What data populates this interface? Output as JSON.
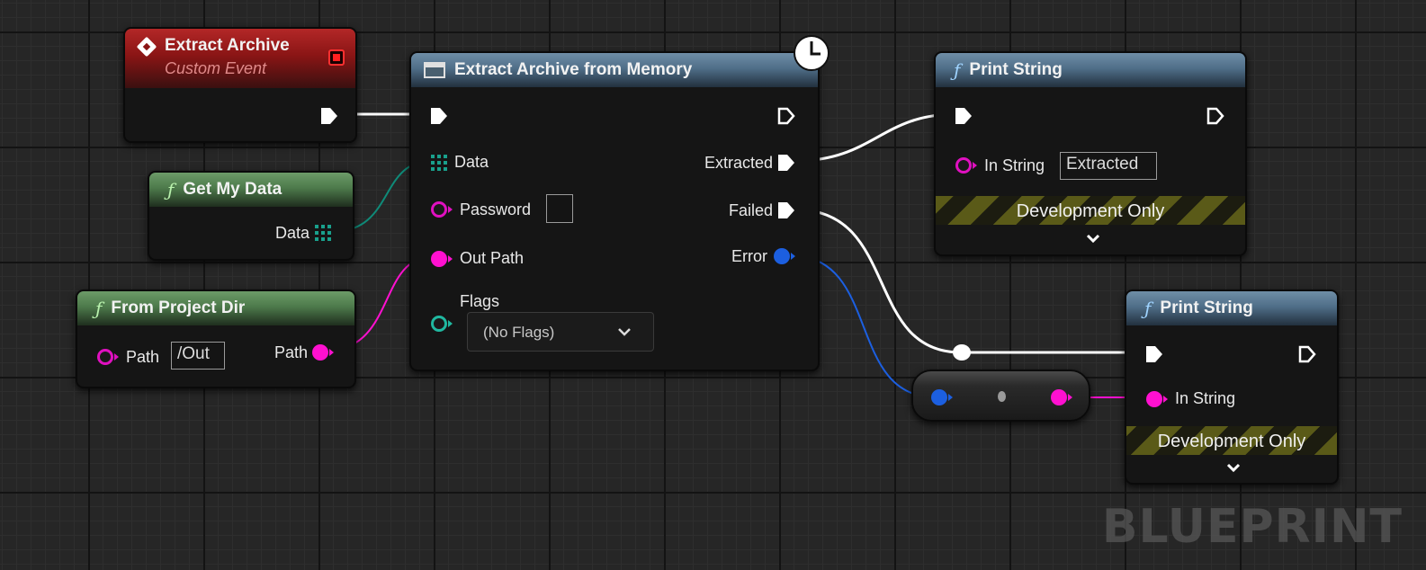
{
  "colors": {
    "exec_wire": "#ffffff",
    "string_wire": "#ff10d0",
    "data_wire": "#0f8a78",
    "error_wire": "#1c5fe0",
    "custom_event_header": "#8a1515",
    "function_header": "#4f6e88",
    "pure_function_header": "#4d7a4b"
  },
  "nodes": {
    "extract_archive_event": {
      "title": "Extract Archive",
      "subtitle": "Custom Event",
      "icon": "custom-event-diamond-icon"
    },
    "extract_archive_from_memory": {
      "title": "Extract Archive from Memory",
      "icon": "function-window-icon",
      "latent_icon": "clock-icon",
      "inputs": {
        "data_label": "Data",
        "password_label": "Password",
        "out_path_label": "Out Path",
        "flags_label": "Flags",
        "flags_value": "(No Flags)"
      },
      "outputs": {
        "extracted_label": "Extracted",
        "failed_label": "Failed",
        "error_label": "Error"
      }
    },
    "get_my_data": {
      "title": "Get My Data",
      "fn_glyph": "ƒ",
      "output_label": "Data"
    },
    "from_project_dir": {
      "title": "From Project Dir",
      "fn_glyph": "ƒ",
      "input_label": "Path",
      "input_value": "/Out",
      "output_label": "Path"
    },
    "print_string_1": {
      "title": "Print String",
      "fn_glyph": "ƒ",
      "in_string_label": "In String",
      "in_string_value": "Extracted",
      "dev_only_label": "Development Only"
    },
    "print_string_2": {
      "title": "Print String",
      "fn_glyph": "ƒ",
      "in_string_label": "In String",
      "dev_only_label": "Development Only"
    }
  },
  "watermark": "BLUEPRINT"
}
